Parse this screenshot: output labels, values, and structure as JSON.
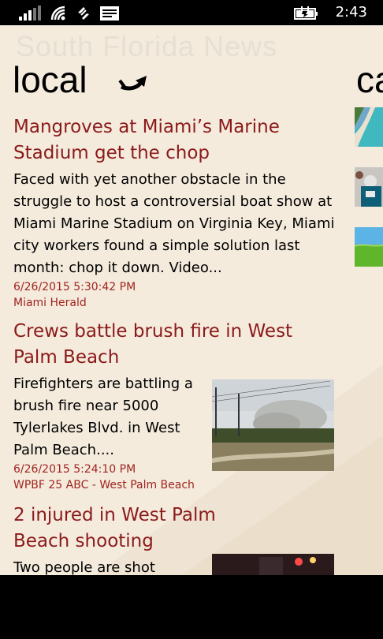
{
  "status_bar": {
    "time": "2:43",
    "icons": [
      "signal-icon",
      "wifi-icon",
      "data-sync-icon",
      "message-icon",
      "battery-charging-icon"
    ]
  },
  "app": {
    "title": "South Florida News",
    "section": "local",
    "next_section_peek": "ca",
    "refresh_icon": "refresh-arrow-icon"
  },
  "articles": [
    {
      "headline": "Mangroves at Miami’s Marine Stadium get the chop",
      "summary": "Faced with yet another obstacle in the struggle to host a controversial boat show at Miami Marine Stadium on Virginia Key, Miami city workers found a simple solution last month: chop it down. Video...",
      "date": "6/26/2015 5:30:42 PM",
      "source": "Miami Herald"
    },
    {
      "headline": "Crews battle brush fire in West Palm Beach",
      "summary": "Firefighters are battling a brush fire near 5000 Tylerlakes Blvd. in West Palm Beach....",
      "date": "6/26/2015 5:24:10 PM",
      "source": "WPBF 25 ABC - West Palm Beach"
    },
    {
      "headline": "2 injured in West Palm Beach shooting",
      "summary": "Two people are shot"
    }
  ],
  "colors": {
    "headline": "#8b1a1a",
    "meta": "#a0241f",
    "background": "#f4ebdd"
  }
}
